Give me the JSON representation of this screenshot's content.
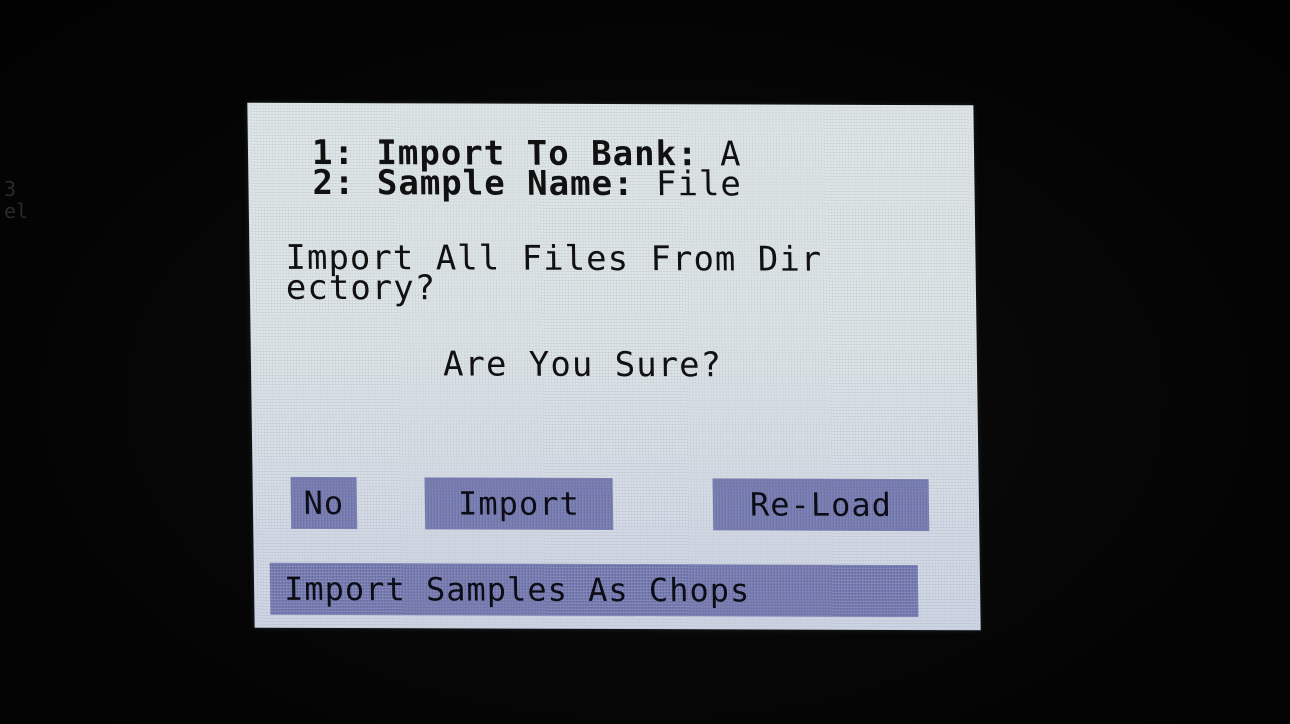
{
  "params": [
    {
      "key": "1: Import To Bank:",
      "value": " A"
    },
    {
      "key": "2: Sample Name:",
      "value": " File"
    }
  ],
  "message": "Import All Files From Dir\nectory?",
  "confirm": "Are You Sure?",
  "buttons": {
    "no": "No",
    "import": "Import",
    "reload": "Re-Load",
    "chops": "Import Samples As Chops"
  },
  "edge_mark": "3\nel",
  "colors": {
    "screen_bg": "#dfe7e8",
    "button_bg": "#7b80b8",
    "text": "#111111"
  }
}
